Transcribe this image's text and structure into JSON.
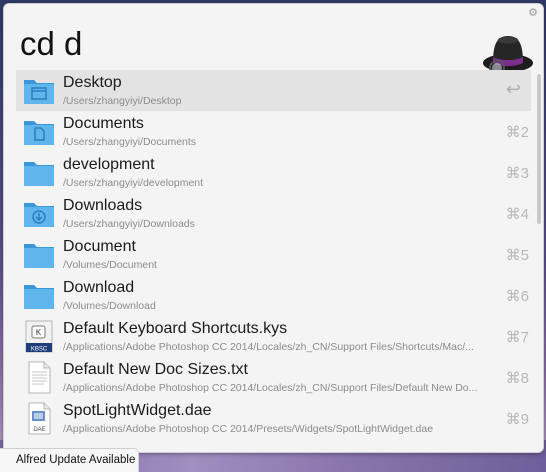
{
  "app": {
    "name": "Alfred",
    "query": "cd d",
    "update_notice": "Alfred Update Available"
  },
  "results": [
    {
      "title": "Desktop",
      "subtitle": "/Users/zhangyiyi/Desktop",
      "shortcut": "↩",
      "icon": "folder-desktop-icon",
      "selected": true
    },
    {
      "title": "Documents",
      "subtitle": "/Users/zhangyiyi/Documents",
      "shortcut": "⌘2",
      "icon": "folder-documents-icon"
    },
    {
      "title": "development",
      "subtitle": "/Users/zhangyiyi/development",
      "shortcut": "⌘3",
      "icon": "folder-icon"
    },
    {
      "title": "Downloads",
      "subtitle": "/Users/zhangyiyi/Downloads",
      "shortcut": "⌘4",
      "icon": "folder-downloads-icon"
    },
    {
      "title": "Document",
      "subtitle": "/Volumes/Document",
      "shortcut": "⌘5",
      "icon": "folder-icon"
    },
    {
      "title": "Download",
      "subtitle": "/Volumes/Download",
      "shortcut": "⌘6",
      "icon": "folder-icon"
    },
    {
      "title": "Default Keyboard Shortcuts.kys",
      "subtitle": "/Applications/Adobe Photoshop CC 2014/Locales/zh_CN/Support Files/Shortcuts/Mac/...",
      "shortcut": "⌘7",
      "icon": "kbsc-file-icon",
      "icon_label": "KBSC"
    },
    {
      "title": "Default New Doc Sizes.txt",
      "subtitle": "/Applications/Adobe Photoshop CC 2014/Locales/zh_CN/Support Files/Default New Do...",
      "shortcut": "⌘8",
      "icon": "text-file-icon"
    },
    {
      "title": "SpotLightWidget.dae",
      "subtitle": "/Applications/Adobe Photoshop CC 2014/Presets/Widgets/SpotLightWidget.dae",
      "shortcut": "⌘9",
      "icon": "dae-file-icon",
      "icon_label": "DAE"
    }
  ],
  "colors": {
    "folder": "#5fb6ec",
    "folder_dark": "#3a97d8",
    "selected_row": "#e3e3e3",
    "hat_band": "#7a2f8f"
  }
}
